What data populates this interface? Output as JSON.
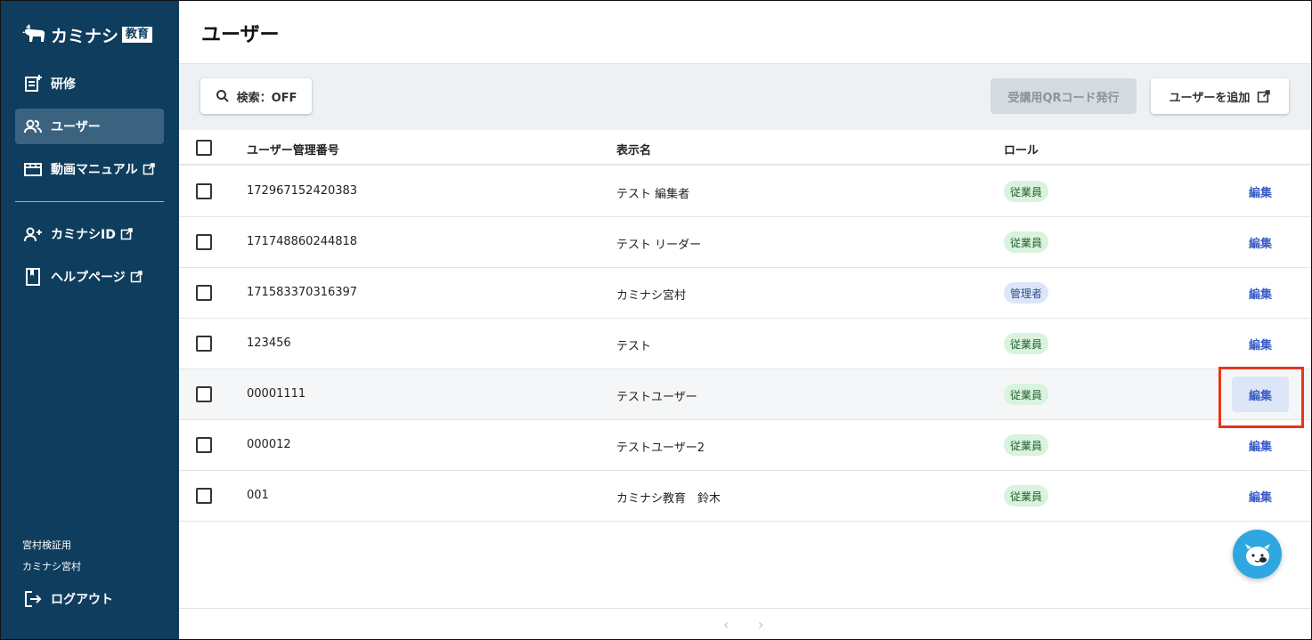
{
  "brand": {
    "name": "カミナシ",
    "badge": "教育"
  },
  "sidebar": {
    "items": [
      {
        "label": "研修",
        "icon": "document-add-icon"
      },
      {
        "label": "ユーザー",
        "icon": "users-icon",
        "active": true
      },
      {
        "label": "動画マニュアル",
        "icon": "video-icon",
        "external": true
      },
      {
        "label": "カミナシID",
        "icon": "user-add-icon",
        "external": true
      },
      {
        "label": "ヘルプページ",
        "icon": "book-icon",
        "external": true
      }
    ],
    "account": {
      "org": "宮村検証用",
      "user": "カミナシ宮村"
    },
    "logout_label": "ログアウト"
  },
  "page": {
    "title": "ユーザー"
  },
  "toolbar": {
    "search_label": "検索：OFF",
    "qr_label": "受講用QRコード発行",
    "add_label": "ユーザーを追加"
  },
  "table": {
    "columns": [
      "ユーザー管理番号",
      "表示名",
      "ロール"
    ],
    "edit_label": "編集",
    "rows": [
      {
        "id": "172967152420383",
        "name": "テスト 編集者",
        "role": "従業員"
      },
      {
        "id": "171748860244818",
        "name": "テスト リーダー",
        "role": "従業員"
      },
      {
        "id": "171583370316397",
        "name": "カミナシ宮村",
        "role": "管理者"
      },
      {
        "id": "123456",
        "name": "テスト",
        "role": "従業員"
      },
      {
        "id": "00001111",
        "name": "テストユーザー",
        "role": "従業員"
      },
      {
        "id": "000012",
        "name": "テストユーザー2",
        "role": "従業員"
      },
      {
        "id": "001",
        "name": "カミナシ教育　鈴木",
        "role": "従業員"
      }
    ]
  },
  "pager": {
    "prev": "‹",
    "next": "›"
  },
  "colors": {
    "sidebar": "#0f3d5e",
    "accent": "#3a5cc7",
    "highlight": "#e8351a"
  }
}
